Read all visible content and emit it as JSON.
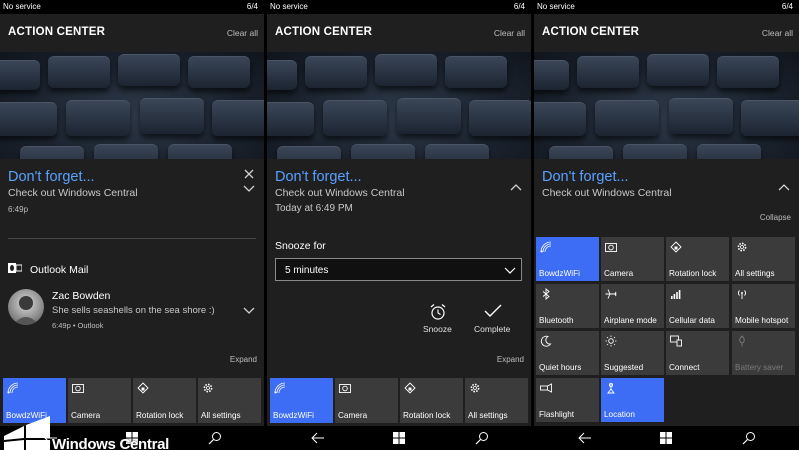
{
  "status": {
    "carrier": "No service",
    "battery": "6/4"
  },
  "header": {
    "title": "ACTION CENTER",
    "clear_all": "Clear all"
  },
  "reminder": {
    "title": "Don't forget...",
    "body": "Check out Windows Central",
    "time": "6:49p",
    "detail_time": "Today at 6:49 PM"
  },
  "outlook": {
    "app": "Outlook Mail",
    "sender": "Zac Bowden",
    "message": "She sells seashells on the sea shore :)",
    "meta": "6:49p • Outlook"
  },
  "snooze": {
    "label": "Snooze for",
    "selected": "5 minutes",
    "snooze_action": "Snooze",
    "complete_action": "Complete"
  },
  "labels": {
    "expand": "Expand",
    "collapse": "Collapse"
  },
  "tiles_collapsed": [
    {
      "label": "BowdzWiFi",
      "icon": "wifi-icon",
      "active": true
    },
    {
      "label": "Camera",
      "icon": "camera-icon",
      "active": false
    },
    {
      "label": "Rotation lock",
      "icon": "rotation-lock-icon",
      "active": false
    },
    {
      "label": "All settings",
      "icon": "gear-icon",
      "active": false
    }
  ],
  "tiles_expanded": [
    {
      "label": "BowdzWiFi",
      "icon": "wifi-icon",
      "active": true
    },
    {
      "label": "Camera",
      "icon": "camera-icon",
      "active": false
    },
    {
      "label": "Rotation lock",
      "icon": "rotation-lock-icon",
      "active": false
    },
    {
      "label": "All settings",
      "icon": "gear-icon",
      "active": false
    },
    {
      "label": "Bluetooth",
      "icon": "bluetooth-icon",
      "active": false
    },
    {
      "label": "Airplane mode",
      "icon": "airplane-icon",
      "active": false
    },
    {
      "label": "Cellular data",
      "icon": "cellular-icon",
      "active": false
    },
    {
      "label": "Mobile hotspot",
      "icon": "hotspot-icon",
      "active": false
    },
    {
      "label": "Quiet hours",
      "icon": "moon-icon",
      "active": false
    },
    {
      "label": "Suggested",
      "icon": "brightness-icon",
      "active": false
    },
    {
      "label": "Connect",
      "icon": "connect-icon",
      "active": false
    },
    {
      "label": "Battery saver",
      "icon": "battery-saver-icon",
      "active": false,
      "disabled": true
    },
    {
      "label": "Flashlight",
      "icon": "flashlight-icon",
      "active": false
    },
    {
      "label": "Location",
      "icon": "location-icon",
      "active": true
    }
  ],
  "watermark": {
    "text": "Windows Central"
  },
  "colors": {
    "accent": "#3e6df5",
    "reminder_title": "#5aa0ff",
    "tile": "#3b3b3b",
    "background": "#1f1f1f"
  }
}
